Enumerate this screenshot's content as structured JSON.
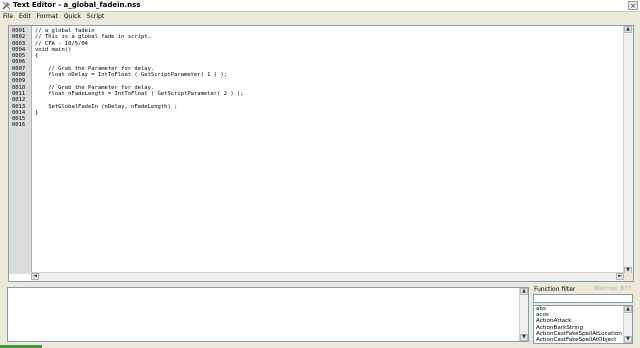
{
  "window": {
    "title": "Text Editor - a_global_fadein.nss",
    "close_label": "×"
  },
  "menu": [
    "File",
    "Edit",
    "Format",
    "Quick",
    "Script"
  ],
  "editor": {
    "line_numbers": [
      "0001",
      "0002",
      "0003",
      "0004",
      "0005",
      "0006",
      "0007",
      "0008",
      "0009",
      "0010",
      "0011",
      "0012",
      "0013",
      "0014",
      "0015",
      "0016"
    ],
    "lines": [
      "// a_global_fadein",
      "// This is a global fade in script.",
      "// CFA - 10/5/04",
      "void main()",
      "{",
      "",
      "    // Grab the Parameter for delay.",
      "    float nDelay = IntToFloat ( GetScriptParameter( 1 ) );",
      "",
      "    // Grab the Parameter for delay.",
      "    float nFadeLength = IntToFloat ( GetScriptParameter( 2 ) );",
      "",
      "    SetGlobalFadeIn (nDelay, nFadeLength) ;",
      "}",
      "",
      ""
    ]
  },
  "function_filter": {
    "label": "Function filter",
    "matches": "Matches: 877",
    "value": "",
    "items": [
      "abs",
      "acos",
      "ActionAttack",
      "ActionBarkString",
      "ActionCastFakeSpellAtLocation",
      "ActionCastFakeSpellAtObject"
    ]
  },
  "scroll_arrows": {
    "up": "▲",
    "down": "▼",
    "left": "◄",
    "right": "►"
  },
  "colors": {
    "editor_border": "#7f9db9",
    "gutter": "#dcdcdc",
    "status_progress": "#3a9b3a"
  }
}
